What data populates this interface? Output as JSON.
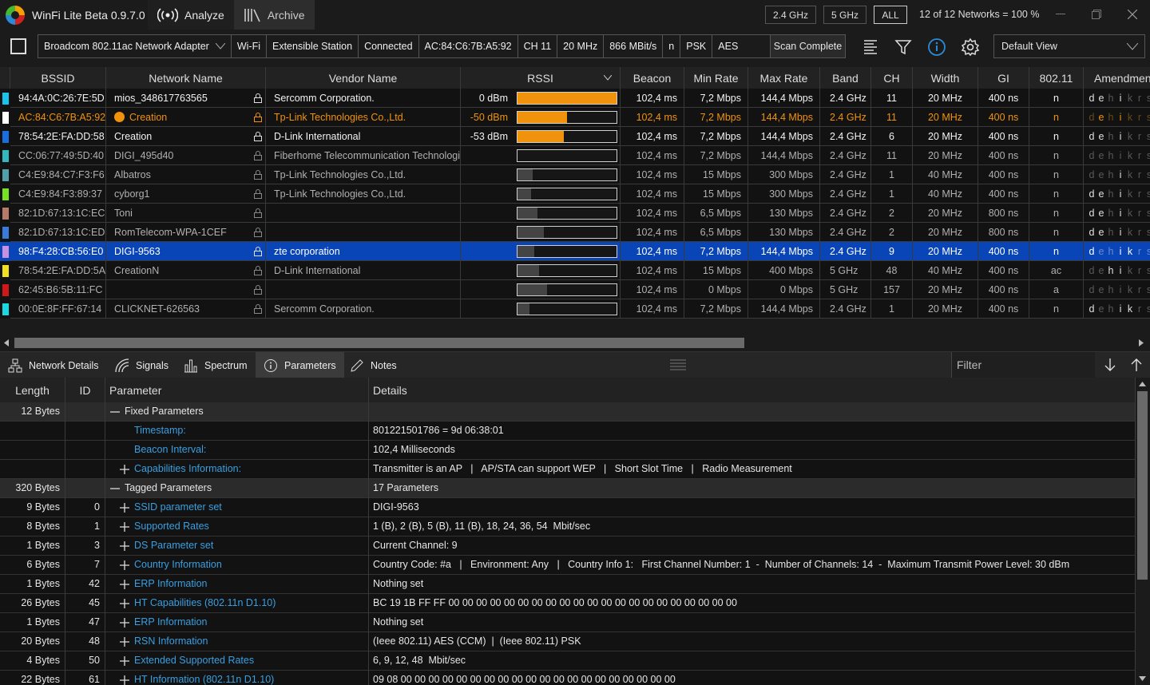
{
  "app": {
    "title": "WinFi Lite Beta 0.9.7.0",
    "nav": [
      {
        "label": "Analyze",
        "active": true
      },
      {
        "label": "Archive",
        "active": false
      }
    ]
  },
  "filters": {
    "band24": "2.4 GHz",
    "band5": "5 GHz",
    "all": "ALL",
    "count": "12 of 12 Networks = 100 %"
  },
  "adapter": {
    "cells": [
      "Broadcom 802.11ac Network Adapter",
      "Wi-Fi",
      "Extensible Station",
      "Connected",
      "AC:84:C6:7B:A5:92",
      "CH 11",
      "20 MHz",
      "866 MBit/s",
      "n",
      "PSK",
      "AES"
    ],
    "scan": "Scan Complete",
    "view": "Default View"
  },
  "table": {
    "headers": [
      "BSSID",
      "Network Name",
      "Vendor Name",
      "RSSI",
      "Beacon",
      "Min Rate",
      "Max Rate",
      "Band",
      "CH",
      "Width",
      "GI",
      "802.11",
      "Amendments"
    ],
    "amendment_letters": [
      "d",
      "e",
      "h",
      "i",
      "k",
      "r",
      "s"
    ],
    "rows": [
      {
        "color": "#18c4e8",
        "bssid": "94:4A:0C:26:7E:5D",
        "name": "mios_348617763565",
        "vendor": "Sercomm Corporation.",
        "rssi": "0 dBm",
        "rssi_level": 1.0,
        "beacon": "102,4 ms",
        "min": "7,2 Mbps",
        "max": "144,4 Mbps",
        "band": "2.4 GHz",
        "ch": "11",
        "width": "20 MHz",
        "gi": "400 ns",
        "std": "n",
        "amd": [
          1,
          1,
          0,
          1,
          0,
          0,
          0
        ]
      },
      {
        "color": "#ffffff",
        "bssid": "AC:84:C6:7B:A5:92",
        "name": "Creation",
        "connected": true,
        "vendor": "Tp-Link Technologies Co.,Ltd.",
        "rssi": "-50 dBm",
        "rssi_level": 0.5,
        "beacon": "102,4 ms",
        "min": "7,2 Mbps",
        "max": "144,4 Mbps",
        "band": "2.4 GHz",
        "ch": "11",
        "width": "20 MHz",
        "gi": "400 ns",
        "std": "n",
        "amd": [
          0,
          1,
          0,
          1,
          0,
          0,
          0
        ]
      },
      {
        "color": "#1870e0",
        "bssid": "78:54:2E:FA:DD:58",
        "name": "Creation",
        "vendor": "D-Link International",
        "rssi": "-53 dBm",
        "rssi_level": 0.47,
        "beacon": "102,4 ms",
        "min": "7,2 Mbps",
        "max": "144,4 Mbps",
        "band": "2.4 GHz",
        "ch": "6",
        "width": "20 MHz",
        "gi": "400 ns",
        "std": "n",
        "amd": [
          1,
          1,
          0,
          1,
          0,
          0,
          0
        ]
      },
      {
        "color": "#34b8c0",
        "bssid": "CC:06:77:49:5D:40",
        "name": "DIGI_495d40",
        "vendor": "Fiberhome Telecommunication Technologi",
        "rssi": "",
        "rssi_level": 0.0,
        "beacon": "102,4 ms",
        "min": "7,2 Mbps",
        "max": "144,4 Mbps",
        "band": "2.4 GHz",
        "ch": "11",
        "width": "20 MHz",
        "gi": "400 ns",
        "std": "n",
        "amd": [
          0,
          0,
          0,
          0,
          0,
          0,
          0
        ]
      },
      {
        "color": "#52a0a8",
        "bssid": "C4:E9:84:C7:F3:F6",
        "name": "Albatros",
        "vendor": "Tp-Link Technologies Co.,Ltd.",
        "rssi": "",
        "rssi_level": 0.15,
        "beacon": "102,4 ms",
        "min": "15 Mbps",
        "max": "300 Mbps",
        "band": "2.4 GHz",
        "ch": "1",
        "width": "40 MHz",
        "gi": "400 ns",
        "std": "n",
        "amd": [
          0,
          0,
          0,
          1,
          0,
          0,
          0
        ]
      },
      {
        "color": "#78e020",
        "bssid": "C4:E9:84:F3:89:37",
        "name": "cyborg1",
        "vendor": "Tp-Link Technologies Co.,Ltd.",
        "rssi": "",
        "rssi_level": 0.14,
        "beacon": "102,4 ms",
        "min": "15 Mbps",
        "max": "300 Mbps",
        "band": "2.4 GHz",
        "ch": "1",
        "width": "40 MHz",
        "gi": "400 ns",
        "std": "n",
        "amd": [
          1,
          1,
          0,
          1,
          0,
          0,
          0
        ]
      },
      {
        "color": "#b87a68",
        "bssid": "82:1D:67:13:1C:EC",
        "name": "Toni",
        "vendor": "",
        "rssi": "",
        "rssi_level": 0.2,
        "beacon": "102,4 ms",
        "min": "6,5 Mbps",
        "max": "130 Mbps",
        "band": "2.4 GHz",
        "ch": "2",
        "width": "20 MHz",
        "gi": "800 ns",
        "std": "n",
        "amd": [
          1,
          1,
          0,
          1,
          0,
          0,
          0
        ]
      },
      {
        "color": "#3a7ad8",
        "bssid": "82:1D:67:13:1C:ED",
        "name": "RomTelecom-WPA-1CEF",
        "vendor": "",
        "rssi": "",
        "rssi_level": 0.27,
        "beacon": "102,4 ms",
        "min": "6,5 Mbps",
        "max": "130 Mbps",
        "band": "2.4 GHz",
        "ch": "2",
        "width": "20 MHz",
        "gi": "800 ns",
        "std": "n",
        "amd": [
          1,
          1,
          0,
          1,
          0,
          0,
          0
        ]
      },
      {
        "color": "#c890e0",
        "bssid": "98:F4:28:CB:56:E0",
        "name": "DIGI-9563",
        "vendor": "zte corporation",
        "selected": true,
        "rssi": "",
        "rssi_level": 0.17,
        "beacon": "102,4 ms",
        "min": "7,2 Mbps",
        "max": "144,4 Mbps",
        "band": "2.4 GHz",
        "ch": "9",
        "width": "20 MHz",
        "gi": "400 ns",
        "std": "n",
        "amd": [
          1,
          0,
          0,
          1,
          1,
          0,
          0
        ]
      },
      {
        "color": "#f0e020",
        "bssid": "78:54:2E:FA:DD:5A",
        "name": "CreationN",
        "vendor": "D-Link International",
        "rssi": "",
        "rssi_level": 0.22,
        "beacon": "102,4 ms",
        "min": "15 Mbps",
        "max": "400 Mbps",
        "band": "5 GHz",
        "ch": "48",
        "width": "40 MHz",
        "gi": "400 ns",
        "std": "ac",
        "amd": [
          0,
          0,
          1,
          1,
          0,
          0,
          0
        ]
      },
      {
        "color": "#d01818",
        "bssid": "62:45:B6:5B:11:FC",
        "name": "",
        "vendor": "",
        "rssi": "",
        "rssi_level": 0.3,
        "beacon": "102,4 ms",
        "min": "0 Mbps",
        "max": "0 Mbps",
        "band": "5 GHz",
        "ch": "157",
        "width": "20 MHz",
        "gi": "400 ns",
        "std": "a",
        "amd": [
          0,
          0,
          0,
          0,
          0,
          0,
          0
        ]
      },
      {
        "color": "#18d8e0",
        "bssid": "00:0E:8F:FF:67:14",
        "name": "CLICKNET-626563",
        "vendor": "Sercomm Corporation.",
        "rssi": "",
        "rssi_level": 0.12,
        "beacon": "102,4 ms",
        "min": "7,2 Mbps",
        "max": "144,4 Mbps",
        "band": "2.4 GHz",
        "ch": "1",
        "width": "20 MHz",
        "gi": "400 ns",
        "std": "n",
        "amd": [
          1,
          0,
          0,
          1,
          1,
          0,
          0
        ]
      }
    ]
  },
  "tabs": [
    {
      "label": "Network Details",
      "icon": "network-icon"
    },
    {
      "label": "Signals",
      "icon": "signal-icon"
    },
    {
      "label": "Spectrum",
      "icon": "spectrum-icon"
    },
    {
      "label": "Parameters",
      "icon": "info-icon",
      "active": true
    },
    {
      "label": "Notes",
      "icon": "pencil-icon"
    }
  ],
  "filter_placeholder": "Filter",
  "params": {
    "headers": [
      "Length",
      "ID",
      "Parameter",
      "Details"
    ],
    "rows": [
      {
        "len": "12 Bytes",
        "id": "",
        "exp": "minus",
        "indent": 0,
        "name": "Fixed Parameters",
        "blue": false,
        "details": ""
      },
      {
        "len": "",
        "id": "",
        "exp": "",
        "indent": 1,
        "name": "Timestamp:",
        "blue": true,
        "details": "801221501786 = 9d 06:38:01"
      },
      {
        "len": "",
        "id": "",
        "exp": "",
        "indent": 1,
        "name": "Beacon Interval:",
        "blue": true,
        "details": "102,4 Milliseconds"
      },
      {
        "len": "",
        "id": "",
        "exp": "plus",
        "indent": 1,
        "name": "Capabilities Information:",
        "blue": true,
        "details": "Transmitter is an AP   |   AP/STA can support WEP   |   Short Slot Time   |   Radio Measurement"
      },
      {
        "len": "320 Bytes",
        "id": "",
        "exp": "minus",
        "indent": 0,
        "name": "Tagged Parameters",
        "blue": false,
        "details": "17 Parameters"
      },
      {
        "len": "9 Bytes",
        "id": "0",
        "exp": "plus",
        "indent": 1,
        "name": "SSID parameter set",
        "blue": true,
        "details": "DIGI-9563"
      },
      {
        "len": "8 Bytes",
        "id": "1",
        "exp": "plus",
        "indent": 1,
        "name": "Supported Rates",
        "blue": true,
        "details": "1 (B), 2 (B), 5 (B), 11 (B), 18, 24, 36, 54  Mbit/sec"
      },
      {
        "len": "1 Bytes",
        "id": "3",
        "exp": "plus",
        "indent": 1,
        "name": "DS Parameter set",
        "blue": true,
        "details": "Current Channel: 9"
      },
      {
        "len": "6 Bytes",
        "id": "7",
        "exp": "plus",
        "indent": 1,
        "name": "Country Information",
        "blue": true,
        "details": "Country Code: #a   |   Environment: Any   |   Country Info 1:   First Channel Number: 1  -  Number of Channels: 14  -  Maximum Transmit Power Level: 30 dBm"
      },
      {
        "len": "1 Bytes",
        "id": "42",
        "exp": "plus",
        "indent": 1,
        "name": "ERP Information",
        "blue": true,
        "details": "Nothing set"
      },
      {
        "len": "26 Bytes",
        "id": "45",
        "exp": "plus",
        "indent": 1,
        "name": "HT Capabilities (802.11n D1.10)",
        "blue": true,
        "details": "BC 19 1B FF FF 00 00 00 00 00 00 00 00 00 00 00 00 00 00 00 00 00 00 00 00 00"
      },
      {
        "len": "1 Bytes",
        "id": "47",
        "exp": "plus",
        "indent": 1,
        "name": "ERP Information",
        "blue": true,
        "details": "Nothing set"
      },
      {
        "len": "20 Bytes",
        "id": "48",
        "exp": "plus",
        "indent": 1,
        "name": "RSN Information",
        "blue": true,
        "details": "(Ieee 802.11) AES (CCM)  |  (Ieee 802.11) PSK"
      },
      {
        "len": "4 Bytes",
        "id": "50",
        "exp": "plus",
        "indent": 1,
        "name": "Extended Supported Rates",
        "blue": true,
        "details": "6, 9, 12, 48  Mbit/sec"
      },
      {
        "len": "22 Bytes",
        "id": "61",
        "exp": "plus",
        "indent": 1,
        "name": "HT Information (802.11n D1.10)",
        "blue": true,
        "details": "09 08 00 00 00 00 00 00 00 00 00 00 00 00 00 00 00 00 00 00 00 00"
      }
    ]
  },
  "colors": {
    "accent_orange": "#f0920c",
    "selected_row": "#0a45b8",
    "link_blue": "#3a9fe0"
  }
}
